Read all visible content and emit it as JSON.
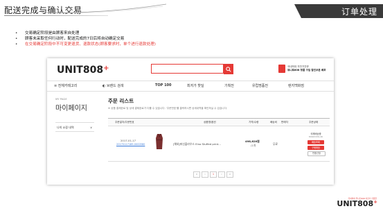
{
  "slide": {
    "title": "配送完成与确认交易",
    "corner_label": "订单处理",
    "bullets": [
      {
        "text": "交易确定阶段是由顾客来自处理",
        "color": "#111111"
      },
      {
        "text": "顾客未采取任何行动时，配送完成的7日后将自动确定交易",
        "color": "#111111"
      },
      {
        "text": "在交易确定阶段中不可变更退货、退款状态(顾客要求时，单个进行退款处理)",
        "color": "#e53935"
      }
    ]
  },
  "site": {
    "logo": "UNIT808",
    "logo_plus": "+",
    "search": {
      "placeholder": "",
      "value": ""
    },
    "search_icon": "search-icon",
    "promo": {
      "line1": "국내최대 자전거전문",
      "line2": "유니트808 정품 구입 할인쿠폰 배포"
    },
    "nav": {
      "all_categories": "≡ 전체카테고리",
      "brand_search": "◐ 브랜드 검색",
      "items": [
        "TOP 100",
        "최저가 핫딜",
        "기획전",
        "유럽명품전",
        "렌지백화점"
      ]
    },
    "sidebar": {
      "label": "MY PAGE",
      "title": "마이페이지",
      "menu_label": "나의 쇼핑 내역",
      "menu_chevron": "∨"
    },
    "main": {
      "title": "주문 리스트",
      "note": "※ 상품 결제완료 및 상세 결제완료가 다를 수 있습니다. '주문번호'를 클릭하시면 상세내역을 확인하실 수 있습니다.",
      "headers": [
        "주문일자/주문번호",
        "상품명/옵션",
        "가격/수량",
        "배송비",
        "판매자",
        "주문상태"
      ],
      "row": {
        "date": "2017-01-17",
        "order_no": "20170117189-0000580",
        "product": "[해외]머신플라우스 Elno Stuffed print...",
        "price": "498,620원",
        "qty": "/1개",
        "ship": "무료",
        "status": "국제배송중",
        "status_sub": "80943159-46",
        "buttons": [
          "배송조회",
          "구매확정",
          "반품신청"
        ]
      },
      "pager": [
        "«",
        "‹",
        "1",
        "›",
        "»"
      ],
      "current_page": "1"
    }
  },
  "footer": {
    "tagline": "국내최대 유니트808 자전거 전문몰",
    "logo": "UNIT808",
    "logo_plus": "+"
  },
  "colors": {
    "accent": "#e53935",
    "dark_tab": "#3a3a3a",
    "link": "#3b7bd9"
  }
}
